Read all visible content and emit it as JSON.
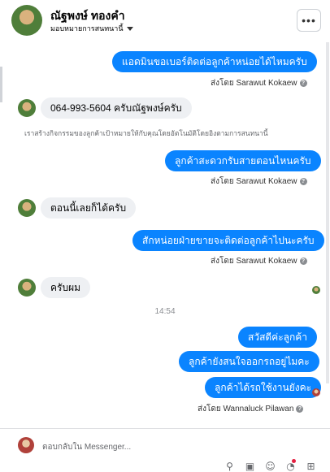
{
  "header": {
    "name": "ณัฐพงษ์ ทองคำ",
    "subtitle": "มอบหมายการสนทนานี้",
    "more_icon": "•••"
  },
  "messages": {
    "m1": "แอดมินขอเบอร์ติดต่อลูกค้าหน่อยได้ไหมครับ",
    "m2": "064-993-5604 ครับณัฐพงษ์ครับ",
    "m3": "ลูกค้าสะดวกรับสายตอนไหนครับ",
    "m4": "ตอนนี้เลยก็ได้ครับ",
    "m5": "สักหน่อยฝ่ายขายจะติดต่อลูกค้าไปนะครับ",
    "m6": "ครับผม",
    "m7": "สวัสดีค่ะลูกค้า",
    "m8": "ลูกค้ายังสนใจออกรถอยู่ไมคะ",
    "m9": "ลูกค้าได้รถใช้งานยังคะ"
  },
  "sent_by": {
    "s1": "ส่งโดย Sarawut Kokaew",
    "s2": "ส่งโดย Sarawut Kokaew",
    "s3": "ส่งโดย Sarawut Kokaew",
    "s4": "ส่งโดย Wannaluck Pilawan"
  },
  "help_glyph": "?",
  "system_note": "เราสร้างกิจกรรมของลูกค้าเป้าหมายให้กับคุณโดยอัตโนมัติโดยอิงตามการสนทนานี้",
  "timestamp": "14:54",
  "composer": {
    "placeholder": "ตอบกลับใน Messenger..."
  },
  "toolbar_icons": [
    "paperclip-icon",
    "image-icon",
    "emoji-icon",
    "sticker-icon",
    "grid-icon"
  ],
  "colors": {
    "outgoing_bubble": "#0a84ff",
    "incoming_bubble": "#eef0f3",
    "notification_dot": "#e41e3f"
  }
}
